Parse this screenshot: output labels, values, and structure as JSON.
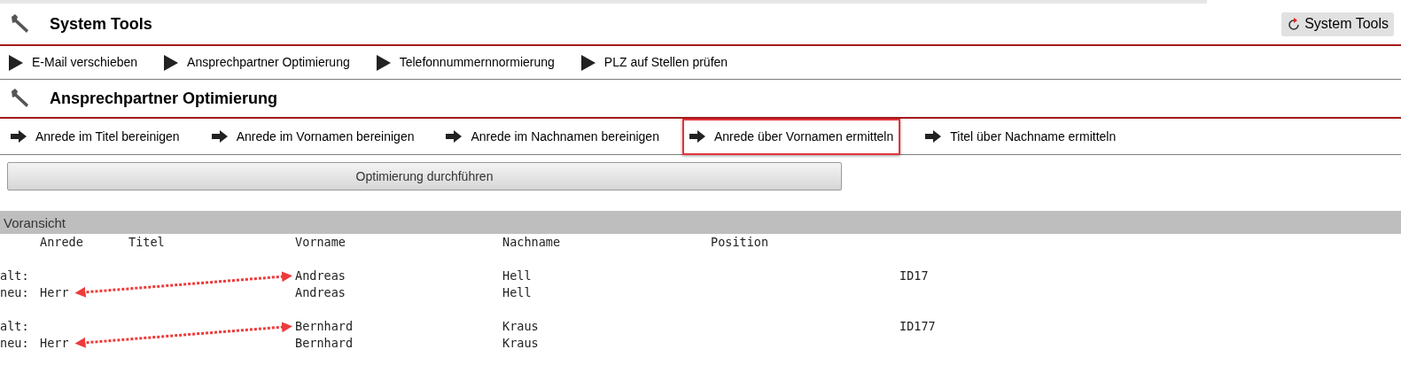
{
  "header": {
    "title": "System Tools",
    "button": "System Tools"
  },
  "tools_nav": [
    {
      "label": "E-Mail verschieben"
    },
    {
      "label": "Ansprechpartner Optimierung"
    },
    {
      "label": "Telefonnummernnormierung"
    },
    {
      "label": "PLZ auf Stellen prüfen"
    }
  ],
  "section": {
    "title": "Ansprechpartner Optimierung"
  },
  "sub_nav": [
    {
      "label": "Anrede im Titel bereinigen",
      "highlighted": false
    },
    {
      "label": "Anrede im Vornamen bereinigen",
      "highlighted": false
    },
    {
      "label": "Anrede im Nachnamen bereinigen",
      "highlighted": false
    },
    {
      "label": "Anrede über Vornamen ermitteln",
      "highlighted": true
    },
    {
      "label": "Titel über Nachname ermitteln",
      "highlighted": false
    }
  ],
  "action_button": "Optimierung durchführen",
  "preview": {
    "title": "Voransicht",
    "columns": [
      "Anrede",
      "Titel",
      "Vorname",
      "Nachname",
      "Position"
    ],
    "records": [
      {
        "old": {
          "label": "alt:",
          "vorname": "Andreas",
          "nachname": "Hell",
          "id": "ID17"
        },
        "new": {
          "label": "neu:",
          "anrede": "Herr",
          "vorname": "Andreas",
          "nachname": "Hell"
        },
        "arrow": true
      },
      {
        "old": {
          "label": "alt:",
          "vorname": "Bernhard",
          "nachname": "Kraus",
          "id": "ID177"
        },
        "new": {
          "label": "neu:",
          "anrede": "Herr",
          "vorname": "Bernhard",
          "nachname": "Kraus"
        },
        "arrow": true
      }
    ]
  }
}
